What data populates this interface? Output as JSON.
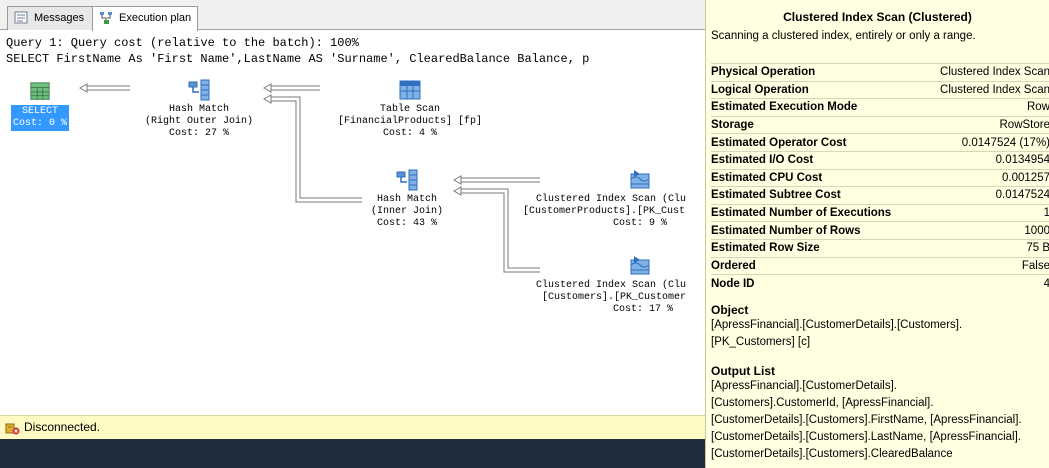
{
  "tabs": [
    {
      "label": "Messages",
      "icon": "messages-icon"
    },
    {
      "label": "Execution plan",
      "icon": "execution-plan-icon"
    }
  ],
  "query": {
    "cost_line": "Query 1: Query cost (relative to the batch): 100%",
    "sql_line": "SELECT FirstName As 'First Name',LastName AS 'Surname', ClearedBalance Balance, p"
  },
  "plan": {
    "nodes": [
      {
        "id": "select",
        "lines": [
          "SELECT",
          "Cost: 0 %"
        ],
        "icon": "select-icon",
        "selected": true
      },
      {
        "id": "hash-match-right-outer",
        "lines": [
          "Hash Match",
          "(Right Outer Join)",
          "Cost: 27 %"
        ],
        "icon": "hash-match-icon"
      },
      {
        "id": "table-scan",
        "lines": [
          "Table Scan",
          "[FinancialProducts] [fp]",
          "Cost: 4 %"
        ],
        "icon": "table-scan-icon"
      },
      {
        "id": "hash-match-inner",
        "lines": [
          "Hash Match",
          "(Inner Join)",
          "Cost: 43 %"
        ],
        "icon": "hash-match-icon"
      },
      {
        "id": "clustered-scan-customerproducts",
        "lines": [
          "Clustered Index Scan (Clu",
          "[CustomerProducts].[PK_Cust",
          "Cost: 9 %"
        ],
        "icon": "clustered-index-scan-icon"
      },
      {
        "id": "clustered-scan-customers",
        "lines": [
          "Clustered Index Scan (Clu",
          "[Customers].[PK_Customer",
          "Cost: 17 %"
        ],
        "icon": "clustered-index-scan-icon"
      }
    ]
  },
  "status": {
    "text": "Disconnected.",
    "icon": "disconnected-icon"
  },
  "tooltip": {
    "title": "Clustered Index Scan (Clustered)",
    "description": "Scanning a clustered index, entirely or only a range.",
    "properties": [
      {
        "key": "Physical Operation",
        "value": "Clustered Index Scan"
      },
      {
        "key": "Logical Operation",
        "value": "Clustered Index Scan"
      },
      {
        "key": "Estimated Execution Mode",
        "value": "Row"
      },
      {
        "key": "Storage",
        "value": "RowStore"
      },
      {
        "key": "Estimated Operator Cost",
        "value": "0.0147524 (17%)"
      },
      {
        "key": "Estimated I/O Cost",
        "value": "0.0134954"
      },
      {
        "key": "Estimated CPU Cost",
        "value": "0.001257"
      },
      {
        "key": "Estimated Subtree Cost",
        "value": "0.0147524"
      },
      {
        "key": "Estimated Number of Executions",
        "value": "1"
      },
      {
        "key": "Estimated Number of Rows",
        "value": "1000"
      },
      {
        "key": "Estimated Row Size",
        "value": "75 B"
      },
      {
        "key": "Ordered",
        "value": "False"
      },
      {
        "key": "Node ID",
        "value": "4"
      }
    ],
    "object_heading": "Object",
    "object_lines": [
      "[ApressFinancial].[CustomerDetails].[Customers].",
      "[PK_Customers] [c]"
    ],
    "output_heading": "Output List",
    "output_lines": [
      "[ApressFinancial].[CustomerDetails].",
      "[Customers].CustomerId, [ApressFinancial].",
      "[CustomerDetails].[Customers].FirstName, [ApressFinancial].",
      "[CustomerDetails].[Customers].LastName, [ApressFinancial].",
      "[CustomerDetails].[Customers].ClearedBalance"
    ]
  },
  "colors": {
    "selection": "#3399ff",
    "tooltip_bg": "#ffffe1",
    "status_bg": "#fff9c4",
    "taskbar": "#1e2c3c",
    "node_icon_blue": "#2f6fbf",
    "select_icon_green": "#4a9a5a"
  }
}
